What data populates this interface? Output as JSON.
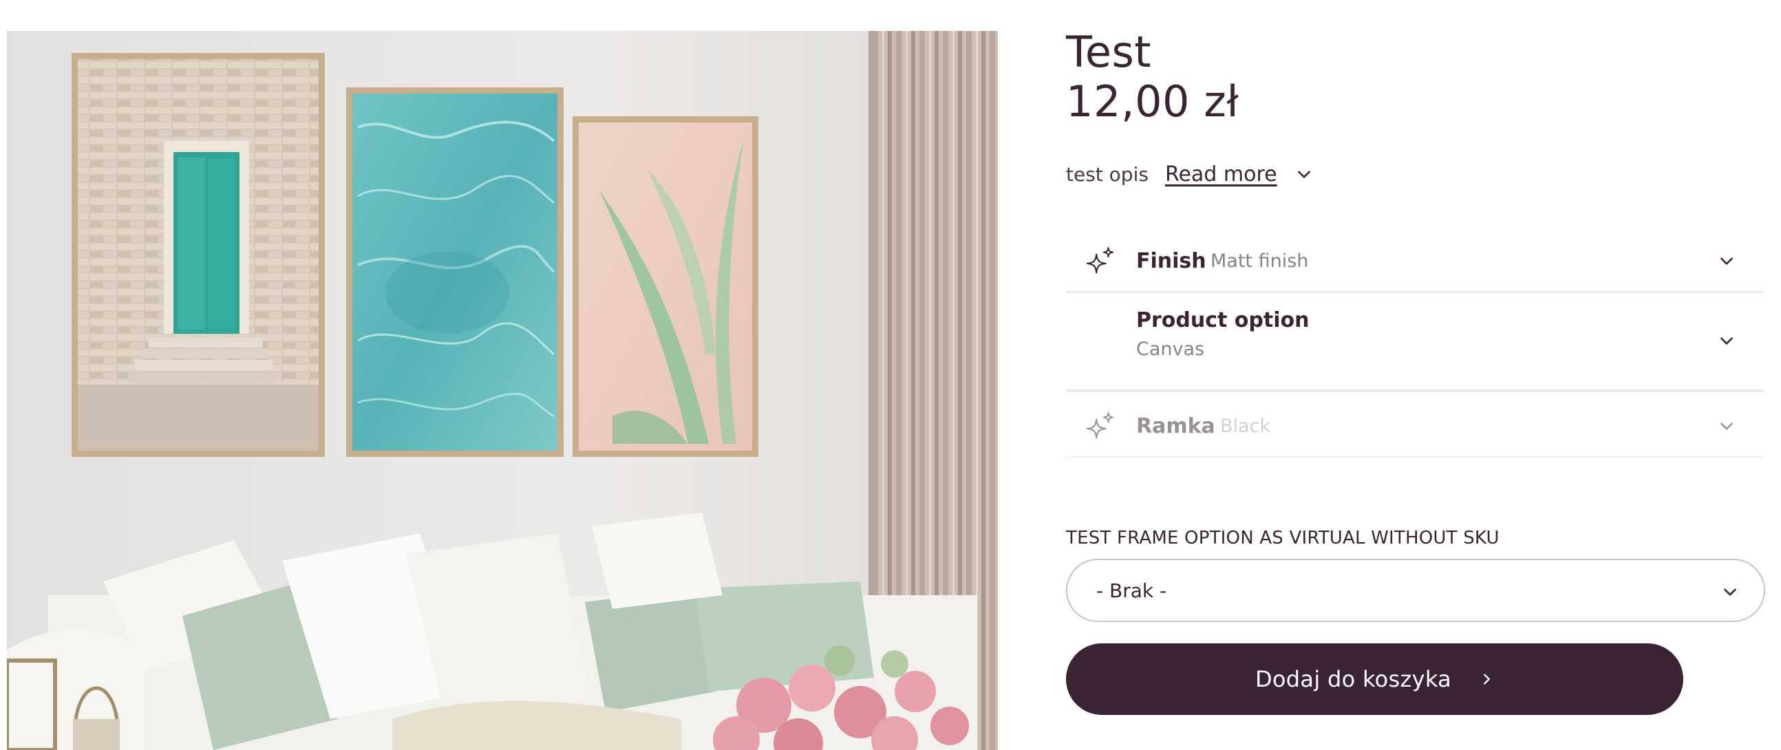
{
  "product": {
    "title": "Test",
    "price": "12,00 zł",
    "description": "test opis",
    "read_more_label": "Read more "
  },
  "options": [
    {
      "name": "Finish",
      "value": "Matt finish",
      "icon": "sparkles-icon",
      "state": "enabled"
    },
    {
      "name": "Product option",
      "value": "Canvas",
      "icon": "none",
      "state": "enabled"
    },
    {
      "name": "Ramka",
      "value": "Black",
      "icon": "sparkles-icon",
      "state": "disabled"
    }
  ],
  "frame_select": {
    "label": "TEST FRAME OPTION AS VIRTUAL WITHOUT SKU",
    "value": "- Brak -"
  },
  "cart": {
    "button_label": "Dodaj do koszyka",
    "icon": "chevron-right-icon"
  },
  "colors": {
    "brand": "#3a2334",
    "text": "#3a2434",
    "muted": "#8a8088",
    "divider": "#ececec"
  }
}
